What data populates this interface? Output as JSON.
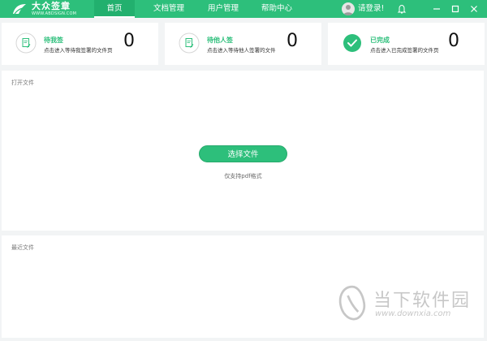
{
  "app": {
    "logo_title": "大众签章",
    "logo_subtitle": "WWW.ABDSIGN.COM",
    "colors": {
      "accent": "#2dbf7b",
      "accent_dark": "#22b06e"
    }
  },
  "nav": {
    "tabs": [
      {
        "label": "首页",
        "active": true
      },
      {
        "label": "文档管理",
        "active": false
      },
      {
        "label": "用户管理",
        "active": false
      },
      {
        "label": "帮助中心",
        "active": false
      }
    ]
  },
  "user": {
    "login_label": "请登录!"
  },
  "window_controls": [
    "bell-icon",
    "minimize-icon",
    "maximize-icon",
    "close-icon"
  ],
  "cards": [
    {
      "title": "待我签",
      "desc": "点击进入等待我签署的文件页",
      "count": "0",
      "icon": "document-pen-icon"
    },
    {
      "title": "待他人签",
      "desc": "点击进入等待他人签署的文件",
      "count": "0",
      "icon": "document-pen-icon"
    },
    {
      "title": "已完成",
      "desc": "点击进入已完成签署的文件页",
      "count": "0",
      "icon": "check-circle-icon"
    }
  ],
  "open_panel": {
    "title": "打开文件",
    "button_label": "选择文件",
    "hint": "仅支持pdf格式"
  },
  "recent_panel": {
    "title": "最近文件"
  },
  "watermark": {
    "text": "当下软件园",
    "url": "www.downxia.com"
  }
}
